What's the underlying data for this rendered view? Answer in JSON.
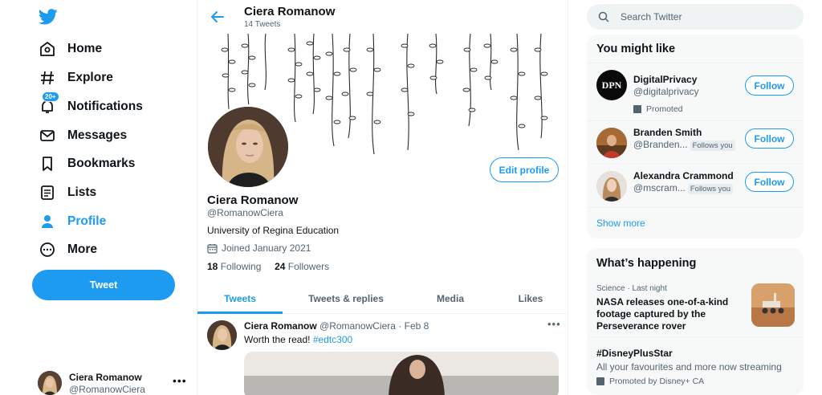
{
  "nav": {
    "items": [
      {
        "label": "Home",
        "icon": "home-icon"
      },
      {
        "label": "Explore",
        "icon": "hash-icon"
      },
      {
        "label": "Notifications",
        "icon": "bell-icon",
        "badge": "20+"
      },
      {
        "label": "Messages",
        "icon": "mail-icon"
      },
      {
        "label": "Bookmarks",
        "icon": "bookmark-icon"
      },
      {
        "label": "Lists",
        "icon": "list-icon"
      },
      {
        "label": "Profile",
        "icon": "user-icon",
        "active": true
      },
      {
        "label": "More",
        "icon": "more-icon"
      }
    ],
    "tweet_button": "Tweet",
    "account": {
      "name": "Ciera Romanow",
      "handle": "@RomanowCiera"
    }
  },
  "header": {
    "name": "Ciera Romanow",
    "tweet_count": "14 Tweets"
  },
  "profile": {
    "edit_button": "Edit profile",
    "name": "Ciera Romanow",
    "handle": "@RomanowCiera",
    "bio": "University of Regina Education",
    "joined": "Joined January 2021",
    "following_count": "18",
    "following_label": "Following",
    "followers_count": "24",
    "followers_label": "Followers"
  },
  "tabs": [
    "Tweets",
    "Tweets & replies",
    "Media",
    "Likes"
  ],
  "tweet": {
    "name": "Ciera Romanow",
    "handle": "@RomanowCiera",
    "sep": "·",
    "date": "Feb 8",
    "text": "Worth the read! ",
    "hashtag": "#edtc300"
  },
  "search": {
    "placeholder": "Search Twitter"
  },
  "suggestions": {
    "title": "You might like",
    "items": [
      {
        "name": "DigitalPrivacy",
        "handle": "@digitalprivacy",
        "promoted": "Promoted",
        "button": "Follow",
        "avatar_text": "DPN"
      },
      {
        "name": "Branden Smith",
        "handle": "@Branden...",
        "follows_you": "Follows you",
        "button": "Follow"
      },
      {
        "name": "Alexandra Crammond",
        "handle": "@mscram...",
        "follows_you": "Follows you",
        "button": "Follow"
      }
    ],
    "show_more": "Show more"
  },
  "happening": {
    "title": "What’s happening",
    "items": [
      {
        "meta": "Science · Last night",
        "title": "NASA releases one-of-a-kind footage captured by the Perseverance rover"
      },
      {
        "title": "#DisneyPlusStar",
        "sub": "All your favourites and more now streaming",
        "promoted": "Promoted by Disney+ CA"
      }
    ]
  },
  "colors": {
    "accent": "#1d9bf0",
    "text": "#0f1419",
    "muted": "#536471"
  }
}
